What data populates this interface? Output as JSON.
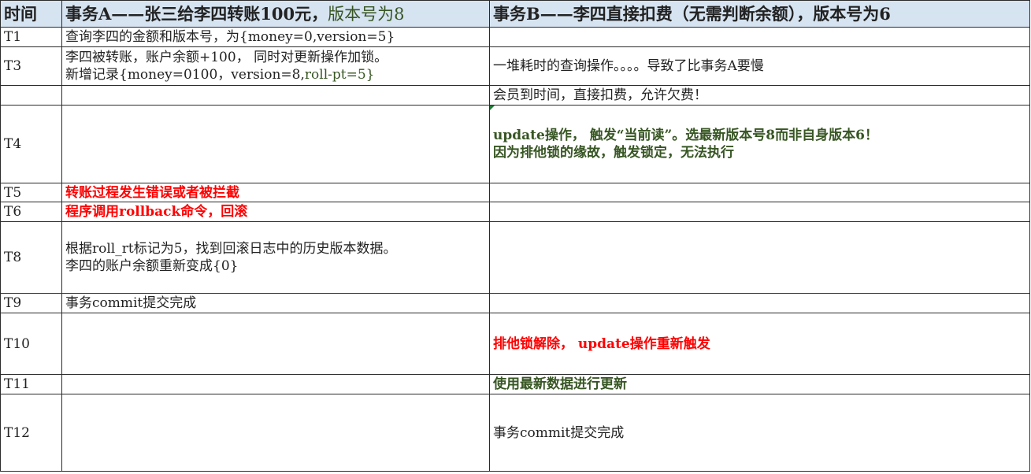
{
  "header": {
    "time": "时间",
    "tx_a_prefix": "事务A——张三给李四转账100元，",
    "tx_a_version": "版本号为8",
    "tx_b": "事务B——李四直接扣费（无需判断余额），版本号为6"
  },
  "rows": [
    {
      "time": "T1",
      "a": [
        "查询李四的金额和版本号，为{money=0,version=5}"
      ],
      "b": []
    },
    {
      "time": "T3",
      "a": [
        "李四被转账，账户余额+100， 同时对更新操作加锁。",
        "新增记录{money=0100，version=8,",
        "roll-pt=5}"
      ],
      "b": [
        "一堆耗时的查询操作。。。。导致了比事务A要慢"
      ]
    },
    {
      "time": "",
      "a": [],
      "b": [
        "会员到时间，直接扣费，允许欠费！"
      ]
    },
    {
      "time": "T4",
      "a": [],
      "b": [
        "update操作， 触发“当前读”。选最新版本号8而非自身版本6！",
        "因为排他锁的缘故，触发锁定，无法执行"
      ]
    },
    {
      "time": "T5",
      "a": [
        "转账过程发生错误或者被拦截"
      ],
      "b": []
    },
    {
      "time": "T6",
      "a": [
        "程序调用rollback命令，回滚"
      ],
      "b": []
    },
    {
      "time": "T8",
      "a": [
        "根据roll_rt标记为5，找到回滚日志中的历史版本数据。",
        "李四的账户余额重新变成{0}"
      ],
      "b": []
    },
    {
      "time": "T9",
      "a": [
        "事务commit提交完成"
      ],
      "b": []
    },
    {
      "time": "T10",
      "a": [],
      "b": [
        "排他锁解除， update操作重新触发"
      ]
    },
    {
      "time": "T11",
      "a": [],
      "b": [
        "使用最新数据进行更新"
      ]
    },
    {
      "time": "T12",
      "a": [],
      "b": [
        "事务commit提交完成"
      ]
    }
  ],
  "colors": {
    "header_bg": "#d6e3f0",
    "green_text": "#375623",
    "red_text": "#ff0000",
    "grid": "#2b2b2b"
  }
}
